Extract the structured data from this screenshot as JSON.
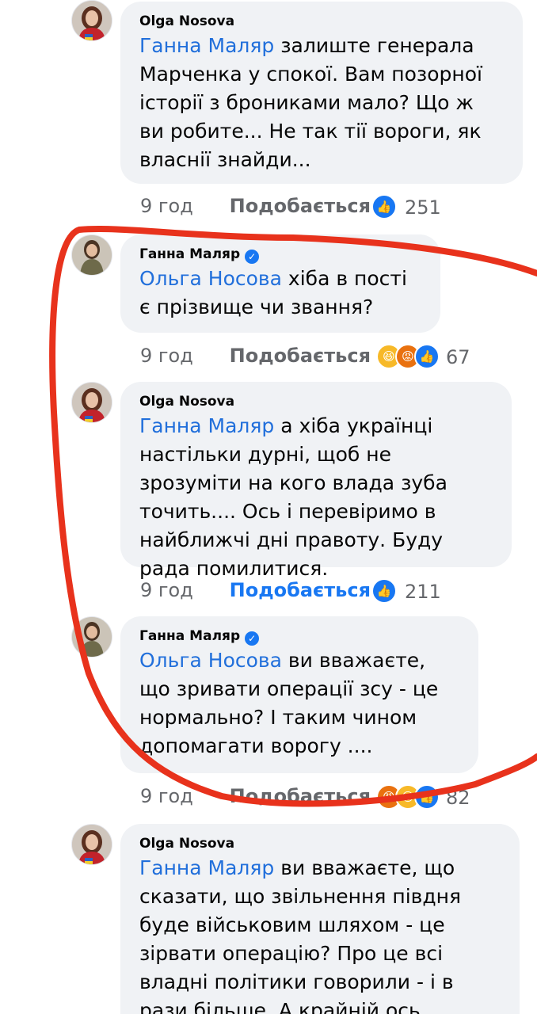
{
  "comments": [
    {
      "author": "Olga  Nosova",
      "mention": "Ганна Маляр",
      "text": " залиште генерала Марченка у спокої. Вам позорної історії з брониками мало? Що ж ви робите... Не так тії вороги, як власнії знайди...",
      "time": "9 год",
      "like_label": "Подобається",
      "like_active": false,
      "reactions": [
        "like"
      ],
      "count": "251"
    },
    {
      "author": "Ганна Маляр",
      "verified": true,
      "mention": "Ольга Носова",
      "text": " хіба в пості є прізвище чи звання?",
      "time": "9 год",
      "like_label": "Подобається",
      "like_active": false,
      "reactions": [
        "haha",
        "angry",
        "like"
      ],
      "count": "67"
    },
    {
      "author": "Olga  Nosova",
      "mention": "Ганна Маляр",
      "text": " а хіба українці настільки дурні, щоб не зрозуміти на кого влада зуба точить.... Ось і перевіримо в найближчі дні правоту. Буду рада помилитися.",
      "time": "9 год",
      "like_label": "Подобається",
      "like_active": true,
      "reactions": [
        "like"
      ],
      "count": "211"
    },
    {
      "author": "Ганна Маляр",
      "verified": true,
      "mention": "Ольга Носова",
      "text": " ви вважаєте, що зривати операції зсу - це нормально?  І таким чином допомагати ворогу ....",
      "time": "9 год",
      "like_label": "Подобається",
      "like_active": false,
      "reactions": [
        "angry",
        "haha",
        "like"
      ],
      "count": "82"
    },
    {
      "author": "Olga  Nosova",
      "mention": "Ганна Маляр",
      "text": " ви вважаєте, що сказати, що звільнення півдня буде військовим шляхом - це зірвати операцію? Про це всі владні політики говорили - і в рази більше. А крайній ось значить хто..."
    }
  ],
  "colors": {
    "mention": "#216fdb",
    "like_active": "#1877f2",
    "meta": "#65676b",
    "bubble": "#f0f2f5",
    "highlight": "#e8321c"
  }
}
